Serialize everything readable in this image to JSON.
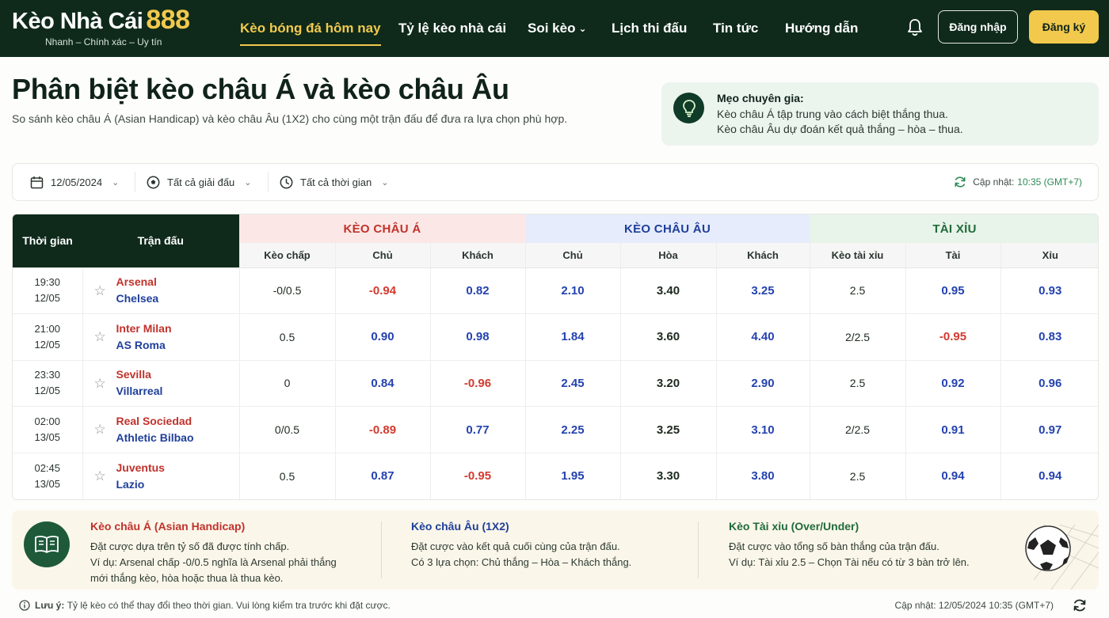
{
  "brand": {
    "name": "Kèo Nhà Cái",
    "number": "888",
    "tagline": "Nhanh – Chính xác – Uy tín",
    "accent": "#f2c94c",
    "header_bg": "#0f2a1b"
  },
  "nav": {
    "items": [
      {
        "label": "Kèo bóng đá hôm nay",
        "active": true
      },
      {
        "label": "Tỷ lệ kèo nhà cái"
      },
      {
        "label": "Soi kèo",
        "has_dropdown": true
      },
      {
        "label": "Lịch thi đấu"
      },
      {
        "label": "Tin tức"
      },
      {
        "label": "Hướng dẫn"
      }
    ],
    "login": "Đăng nhập",
    "register": "Đăng ký",
    "notification_icon": "bell-icon"
  },
  "page": {
    "title": "Phân biệt kèo châu Á và kèo châu Âu",
    "subtitle": "So sánh kèo châu Á (Asian Handicap) và kèo châu Âu (1X2) cho cùng một trận đấu để đưa ra lựa chọn phù hợp."
  },
  "tip": {
    "title": "Mẹo chuyên gia:",
    "lines": [
      "Kèo châu Á tập trung vào cách biệt thắng thua.",
      "Kèo châu Âu dự đoán kết quả thắng – hòa – thua."
    ],
    "icon": "lightbulb-icon"
  },
  "filters": {
    "date": "12/05/2024",
    "league": "Tất cả giải đấu",
    "time": "Tất cả thời gian",
    "update_label": "Cập nhật:",
    "update_time": "10:35 (GMT+7)"
  },
  "table": {
    "headers": {
      "time": "Thời gian",
      "match": "Trận đấu",
      "asia": "KÈO CHÂU Á",
      "europe": "KÈO CHÂU ÂU",
      "over_under": "TÀI XỈU"
    },
    "subheaders": [
      "Kèo chấp",
      "Chủ",
      "Khách",
      "Chủ",
      "Hòa",
      "Khách",
      "Kèo tài xỉu",
      "Tài",
      "Xỉu"
    ],
    "rows": [
      {
        "time": "19:30",
        "date": "12/05",
        "home": "Arsenal",
        "away": "Chelsea",
        "handicap": "-0/0.5",
        "ah_home": "-0.94",
        "ah_away": "0.82",
        "eu_home": "2.10",
        "eu_draw": "3.40",
        "eu_away": "3.25",
        "ou_line": "2.5",
        "over": "0.95",
        "under": "0.93"
      },
      {
        "time": "21:00",
        "date": "12/05",
        "home": "Inter Milan",
        "away": "AS Roma",
        "handicap": "0.5",
        "ah_home": "0.90",
        "ah_away": "0.98",
        "eu_home": "1.84",
        "eu_draw": "3.60",
        "eu_away": "4.40",
        "ou_line": "2/2.5",
        "over": "-0.95",
        "under": "0.83"
      },
      {
        "time": "23:30",
        "date": "12/05",
        "home": "Sevilla",
        "away": "Villarreal",
        "handicap": "0",
        "ah_home": "0.84",
        "ah_away": "-0.96",
        "eu_home": "2.45",
        "eu_draw": "3.20",
        "eu_away": "2.90",
        "ou_line": "2.5",
        "over": "0.92",
        "under": "0.96"
      },
      {
        "time": "02:00",
        "date": "13/05",
        "home": "Real Sociedad",
        "away": "Athletic Bilbao",
        "handicap": "0/0.5",
        "ah_home": "-0.89",
        "ah_away": "0.77",
        "eu_home": "2.25",
        "eu_draw": "3.25",
        "eu_away": "3.10",
        "ou_line": "2/2.5",
        "over": "0.91",
        "under": "0.97"
      },
      {
        "time": "02:45",
        "date": "13/05",
        "home": "Juventus",
        "away": "Lazio",
        "handicap": "0.5",
        "ah_home": "0.87",
        "ah_away": "-0.95",
        "eu_home": "1.95",
        "eu_draw": "3.30",
        "eu_away": "3.80",
        "ou_line": "2.5",
        "over": "0.94",
        "under": "0.94"
      }
    ]
  },
  "info": {
    "asia": {
      "title": "Kèo châu Á (Asian Handicap)",
      "lines": [
        "Đặt cược dựa trên tỷ số đã được tính chấp.",
        "Ví dụ: Arsenal chấp -0/0.5 nghĩa là Arsenal phải thắng",
        "mới thắng kèo, hòa hoặc thua là thua kèo."
      ]
    },
    "europe": {
      "title": "Kèo châu Âu (1X2)",
      "lines": [
        "Đặt cược vào kết quả cuối cùng của trận đấu.",
        "Có 3 lựa chọn: Chủ thắng – Hòa – Khách thắng."
      ]
    },
    "over_under": {
      "title": "Kèo Tài xỉu (Over/Under)",
      "lines": [
        "Đặt cược vào tổng số bàn thắng của trận đấu.",
        "Ví dụ: Tài xỉu 2.5 – Chọn Tài nếu có từ 3 bàn trở lên."
      ]
    }
  },
  "footer": {
    "note_label": "Lưu ý:",
    "note": "Tỷ lệ kèo có thể thay đổi theo thời gian. Vui lòng kiểm tra trước khi đặt cược.",
    "update": "Cập nhật: 12/05/2024 10:35 (GMT+7)"
  }
}
